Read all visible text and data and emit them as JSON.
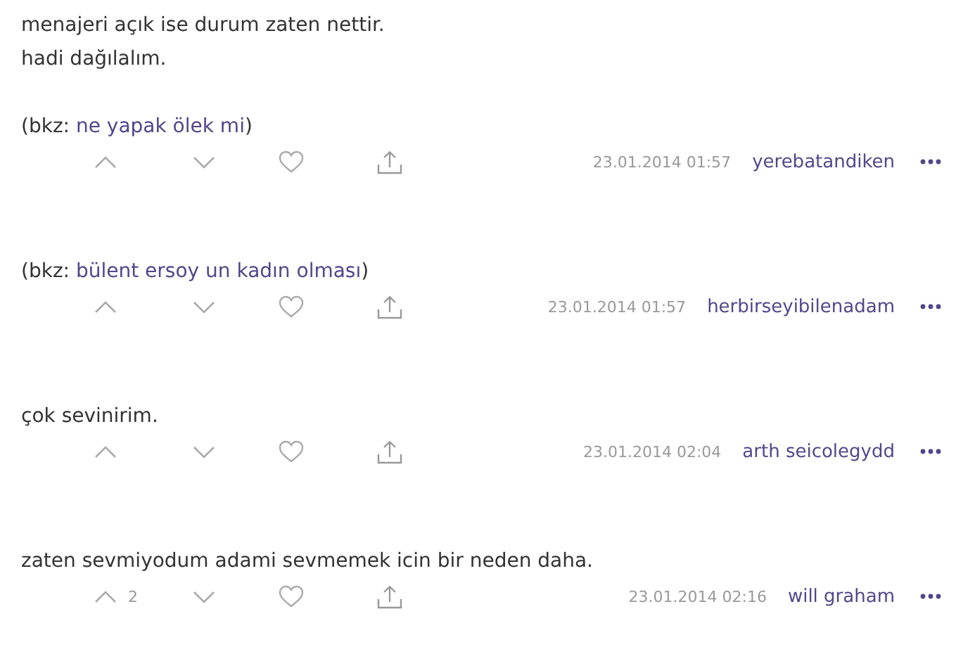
{
  "entries": [
    {
      "paragraphs": [
        [
          {
            "kind": "text",
            "text": "menajeri açık ise durum zaten nettir."
          },
          {
            "kind": "text",
            "text": "hadi dağılalım."
          }
        ],
        [
          {
            "kind": "bkz",
            "before": "(bkz: ",
            "link": "ne yapak ölek mi",
            "after": ")"
          }
        ]
      ],
      "date": "23.01.2014 01:57",
      "author": "yerebatandiken"
    },
    {
      "paragraphs": [
        [
          {
            "kind": "bkz",
            "before": "(bkz: ",
            "link": "bülent ersoy un kadın olması",
            "after": ")"
          }
        ]
      ],
      "date": "23.01.2014 01:57",
      "author": "herbirseyibilenadam"
    },
    {
      "paragraphs": [
        [
          {
            "kind": "text",
            "text": "çok sevinirim."
          }
        ]
      ],
      "date": "23.01.2014 02:04",
      "author": "arth seicolegydd"
    },
    {
      "paragraphs": [
        [
          {
            "kind": "text",
            "text": "zaten sevmiyodum adami sevmemek icin bir neden daha."
          }
        ]
      ],
      "date": "23.01.2014 02:16",
      "author": "will graham",
      "upvotes": "2"
    }
  ]
}
